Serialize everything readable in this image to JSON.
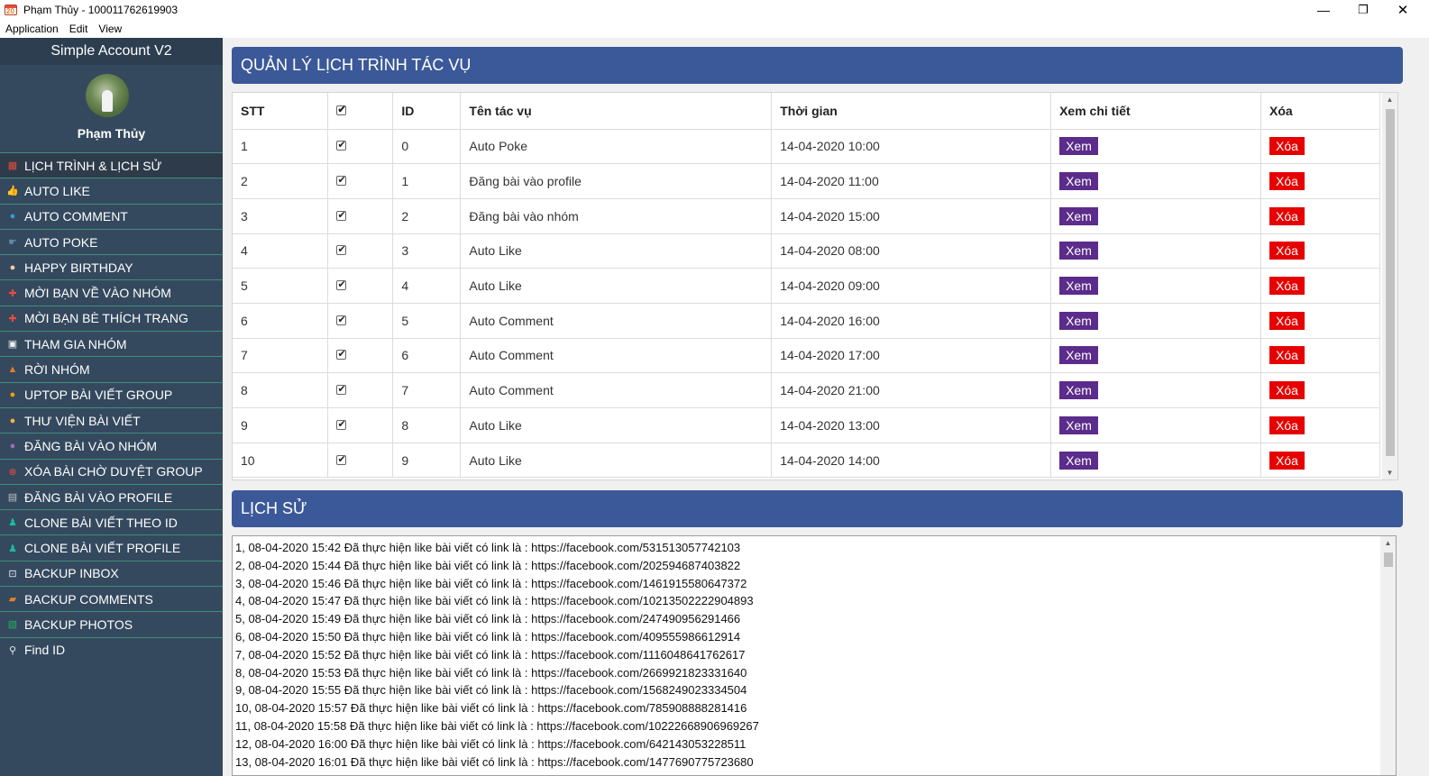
{
  "window": {
    "title": "Phạm Thủy - 100011762619903",
    "minimize": "—",
    "restore": "❐",
    "close": "✕"
  },
  "menubar": [
    "Application",
    "Edit",
    "View"
  ],
  "sidebar": {
    "app_title": "Simple Account V2",
    "user_name": "Phạm Thủy",
    "items": [
      {
        "label": "LỊCH TRÌNH & LỊCH SỬ",
        "icon": "calendar-icon",
        "color": "#e74c3c"
      },
      {
        "label": "AUTO LIKE",
        "icon": "thumbs-up-icon",
        "color": "#f1c40f"
      },
      {
        "label": "AUTO COMMENT",
        "icon": "comment-icon",
        "color": "#3498db"
      },
      {
        "label": "AUTO POKE",
        "icon": "poke-icon",
        "color": "#5d8aa8"
      },
      {
        "label": "HAPPY BIRTHDAY",
        "icon": "birthday-icon",
        "color": "#f5cba7"
      },
      {
        "label": "MỜI BẠN VỀ VÀO NHÓM",
        "icon": "plus-icon",
        "color": "#e74c3c"
      },
      {
        "label": "MỜI BẠN BÈ THÍCH TRANG",
        "icon": "plus-icon",
        "color": "#e74c3c"
      },
      {
        "label": "THAM GIA NHÓM",
        "icon": "join-group-icon",
        "color": "#ecf0f1"
      },
      {
        "label": "RỜI NHÓM",
        "icon": "leave-group-icon",
        "color": "#e67e22"
      },
      {
        "label": "UPTOP BÀI VIẾT GROUP",
        "icon": "uptop-icon",
        "color": "#f39c12"
      },
      {
        "label": "THƯ VIỆN BÀI VIẾT",
        "icon": "library-icon",
        "color": "#f5b041"
      },
      {
        "label": "ĐĂNG BÀI VÀO NHÓM",
        "icon": "post-group-icon",
        "color": "#a569bd"
      },
      {
        "label": "XÓA BÀI CHỜ DUYỆT GROUP",
        "icon": "delete-pending-icon",
        "color": "#e74c3c"
      },
      {
        "label": "ĐĂNG BÀI VÀO PROFILE",
        "icon": "profile-post-icon",
        "color": "#bdc3c7"
      },
      {
        "label": "CLONE BÀI VIẾT THEO ID",
        "icon": "clone-icon",
        "color": "#1abc9c"
      },
      {
        "label": "CLONE BÀI VIẾT PROFILE",
        "icon": "clone-icon",
        "color": "#1abc9c"
      },
      {
        "label": "BACKUP INBOX",
        "icon": "backup-inbox-icon",
        "color": "#ecf0f1"
      },
      {
        "label": "BACKUP COMMENTS",
        "icon": "backup-comments-icon",
        "color": "#e67e22"
      },
      {
        "label": "BACKUP PHOTOS",
        "icon": "backup-photos-icon",
        "color": "#27ae60"
      },
      {
        "label": "Find ID",
        "icon": "magnifier-icon",
        "color": "#ecf0f1"
      }
    ]
  },
  "schedule": {
    "title": "QUẢN LÝ LỊCH TRÌNH TÁC VỤ",
    "columns": [
      "STT",
      "",
      "ID",
      "Tên tác vụ",
      "Thời gian",
      "Xem chi tiết",
      "Xóa"
    ],
    "rows": [
      {
        "stt": "1",
        "id": "0",
        "name": "Auto Poke",
        "time": "14-04-2020 10:00",
        "view": "Xem",
        "delete": "Xóa"
      },
      {
        "stt": "2",
        "id": "1",
        "name": "Đăng bài vào profile",
        "time": "14-04-2020 11:00",
        "view": "Xem",
        "delete": "Xóa"
      },
      {
        "stt": "3",
        "id": "2",
        "name": "Đăng bài vào nhóm",
        "time": "14-04-2020 15:00",
        "view": "Xem",
        "delete": "Xóa"
      },
      {
        "stt": "4",
        "id": "3",
        "name": "Auto Like",
        "time": "14-04-2020 08:00",
        "view": "Xem",
        "delete": "Xóa"
      },
      {
        "stt": "5",
        "id": "4",
        "name": "Auto Like",
        "time": "14-04-2020 09:00",
        "view": "Xem",
        "delete": "Xóa"
      },
      {
        "stt": "6",
        "id": "5",
        "name": "Auto Comment",
        "time": "14-04-2020 16:00",
        "view": "Xem",
        "delete": "Xóa"
      },
      {
        "stt": "7",
        "id": "6",
        "name": "Auto Comment",
        "time": "14-04-2020 17:00",
        "view": "Xem",
        "delete": "Xóa"
      },
      {
        "stt": "8",
        "id": "7",
        "name": "Auto Comment",
        "time": "14-04-2020 21:00",
        "view": "Xem",
        "delete": "Xóa"
      },
      {
        "stt": "9",
        "id": "8",
        "name": "Auto Like",
        "time": "14-04-2020 13:00",
        "view": "Xem",
        "delete": "Xóa"
      },
      {
        "stt": "10",
        "id": "9",
        "name": "Auto Like",
        "time": "14-04-2020 14:00",
        "view": "Xem",
        "delete": "Xóa"
      }
    ]
  },
  "history": {
    "title": "LỊCH SỬ",
    "lines": [
      "1, 08-04-2020 15:42 Đã thực hiện like bài viết có link là : https://facebook.com/531513057742103",
      "2, 08-04-2020 15:44 Đã thực hiện like bài viết có link là : https://facebook.com/202594687403822",
      "3, 08-04-2020 15:46 Đã thực hiện like bài viết có link là : https://facebook.com/1461915580647372",
      "4, 08-04-2020 15:47 Đã thực hiện like bài viết có link là : https://facebook.com/10213502222904893",
      "5, 08-04-2020 15:49 Đã thực hiện like bài viết có link là : https://facebook.com/247490956291466",
      "6, 08-04-2020 15:50 Đã thực hiện like bài viết có link là : https://facebook.com/409555986612914",
      "7, 08-04-2020 15:52 Đã thực hiện like bài viết có link là : https://facebook.com/1116048641762617",
      "8, 08-04-2020 15:53 Đã thực hiện like bài viết có link là : https://facebook.com/2669921823331640",
      "9, 08-04-2020 15:55 Đã thực hiện like bài viết có link là : https://facebook.com/1568249023334504",
      "10, 08-04-2020 15:57 Đã thực hiện like bài viết có link là : https://facebook.com/785908888281416",
      "11, 08-04-2020 15:58 Đã thực hiện like bài viết có link là : https://facebook.com/10222668906969267",
      "12, 08-04-2020 16:00 Đã thực hiện like bài viết có link là : https://facebook.com/642143053228511",
      "13, 08-04-2020 16:01 Đã thực hiện like bài viết có link là : https://facebook.com/1477690775723680"
    ]
  }
}
